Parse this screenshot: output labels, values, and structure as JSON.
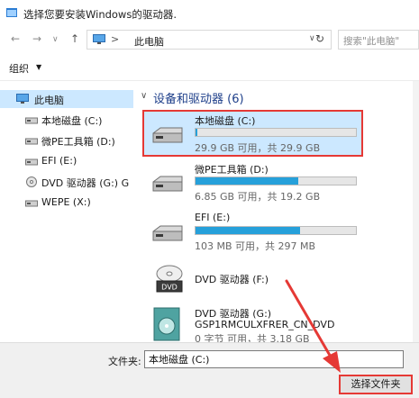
{
  "window": {
    "title": "选择您要安装Windows的驱动器."
  },
  "nav": {
    "back": "←",
    "forward": "→",
    "dropdown": "∨",
    "up": "↑",
    "refresh": "↻",
    "address_sep": ">",
    "address_text": "此电脑",
    "address_chevron": "∨",
    "search_placeholder": "搜索\"此电脑\""
  },
  "toolbar": {
    "organize": "组织",
    "organize_caret": "▼"
  },
  "sidebar": {
    "items": [
      {
        "label": "此电脑",
        "icon": "computer-icon",
        "selected": true
      },
      {
        "label": "本地磁盘 (C:)",
        "icon": "drive-icon"
      },
      {
        "label": "微PE工具箱 (D:)",
        "icon": "drive-icon"
      },
      {
        "label": "EFI (E:)",
        "icon": "drive-icon"
      },
      {
        "label": "DVD 驱动器 (G:) G",
        "icon": "dvd-icon"
      },
      {
        "label": "WEPE (X:)",
        "icon": "drive-icon"
      }
    ]
  },
  "main": {
    "section_caret": "∨",
    "section_title": "设备和驱动器 (6)",
    "drives": [
      {
        "name": "本地磁盘 (C:)",
        "info": "29.9 GB 可用，共 29.9 GB",
        "used_fraction": 0.01,
        "type": "hdd",
        "selected": true
      },
      {
        "name": "微PE工具箱 (D:)",
        "info": "6.85 GB 可用，共 19.2 GB",
        "used_fraction": 0.64,
        "type": "hdd"
      },
      {
        "name": "EFI (E:)",
        "info": "103 MB 可用，共 297 MB",
        "used_fraction": 0.65,
        "type": "hdd"
      },
      {
        "name": "DVD 驱动器 (F:)",
        "type": "dvd",
        "badge": "DVD"
      },
      {
        "name": "DVD 驱动器 (G:)",
        "sub": "GSP1RMCULXFRER_CN_DVD",
        "info": "0 字节 可用，共 3.18 GB",
        "type": "dvd-disc"
      }
    ]
  },
  "footer": {
    "folder_label": "文件夹:",
    "folder_value": "本地磁盘 (C:)",
    "select_button": "选择文件夹"
  },
  "colors": {
    "selection": "#cce8ff",
    "bar_fill": "#26a0da",
    "highlight_red": "#e53935",
    "section_title": "#1e3f8a"
  }
}
